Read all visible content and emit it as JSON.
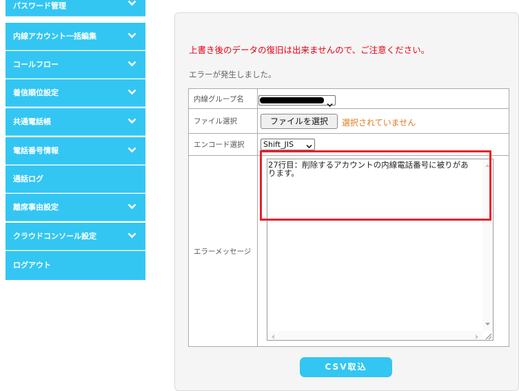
{
  "sidebar": {
    "items": [
      {
        "label": "パスワード管理",
        "has_chevron": true
      },
      {
        "label": "内線アカウント一括編集",
        "has_chevron": true
      },
      {
        "label": "コールフロー",
        "has_chevron": true
      },
      {
        "label": "着信順位設定",
        "has_chevron": true
      },
      {
        "label": "共通電話帳",
        "has_chevron": true
      },
      {
        "label": "電話番号情報",
        "has_chevron": true
      },
      {
        "label": "通話ログ",
        "has_chevron": false
      },
      {
        "label": "離席事由設定",
        "has_chevron": true
      },
      {
        "label": "クラウドコンソール設定",
        "has_chevron": true
      },
      {
        "label": "ログアウト",
        "has_chevron": false
      }
    ]
  },
  "main": {
    "warning": "上書き後のデータの復旧は出来ませんので、ご注意ください。",
    "status": "エラーが発生しました。",
    "form": {
      "group_label": "内線グループ名",
      "file_label": "ファイル選択",
      "file_button": "ファイルを選択",
      "file_status": "選択されていません",
      "encode_label": "エンコード選択",
      "encode_value": "Shift_JIS",
      "error_label": "エラーメッセージ",
      "error_text": "27行目：削除するアカウントの内線電話番号に被りがあります。"
    },
    "import_button": "CSV取込"
  },
  "colors": {
    "sidebar_bg": "#33c6f3",
    "warning": "#e60012",
    "file_status": "#e07a1f",
    "highlight": "#e8202a"
  }
}
